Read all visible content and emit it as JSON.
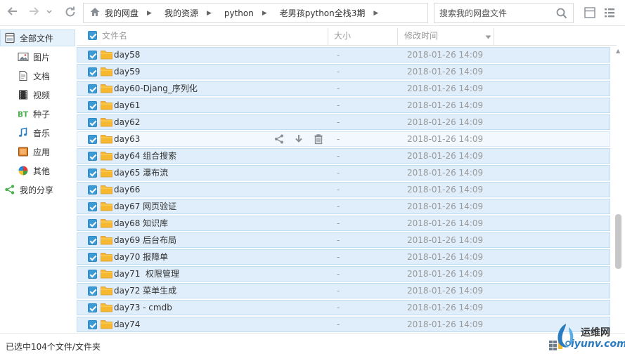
{
  "toolbar": {
    "breadcrumbs": [
      {
        "label": "我的网盘"
      },
      {
        "label": "我的资源"
      },
      {
        "label": "python"
      },
      {
        "label": "老男孩python全栈3期"
      }
    ],
    "search_placeholder": "搜索我的网盘文件"
  },
  "sidebar": {
    "items": [
      {
        "label": "全部文件",
        "icon": "all-files-icon",
        "active": true
      },
      {
        "label": "图片",
        "icon": "image-icon"
      },
      {
        "label": "文档",
        "icon": "document-icon"
      },
      {
        "label": "视频",
        "icon": "video-icon"
      },
      {
        "label": "种子",
        "icon": "bt-icon"
      },
      {
        "label": "音乐",
        "icon": "music-icon"
      },
      {
        "label": "应用",
        "icon": "app-icon"
      },
      {
        "label": "其他",
        "icon": "other-icon"
      },
      {
        "label": "我的分享",
        "icon": "share-icon"
      }
    ]
  },
  "list": {
    "columns": {
      "name": "文件名",
      "size": "大小",
      "modified": "修改时间"
    },
    "rows": [
      {
        "name": "day58",
        "size": "-",
        "modified": "2018-01-26 14:09"
      },
      {
        "name": "day59",
        "size": "-",
        "modified": "2018-01-26 14:09"
      },
      {
        "name": "day60-Djang_序列化",
        "size": "-",
        "modified": "2018-01-26 14:09"
      },
      {
        "name": "day61",
        "size": "-",
        "modified": "2018-01-26 14:09"
      },
      {
        "name": "day62",
        "size": "-",
        "modified": "2018-01-26 14:09"
      },
      {
        "name": "day63",
        "size": "-",
        "modified": "2018-01-26 14:09",
        "hover": true
      },
      {
        "name": "day64 组合搜索",
        "size": "-",
        "modified": "2018-01-26 14:09"
      },
      {
        "name": "day65 瀑布流",
        "size": "-",
        "modified": "2018-01-26 14:09"
      },
      {
        "name": "day66",
        "size": "-",
        "modified": "2018-01-26 14:09"
      },
      {
        "name": "day67 网页验证",
        "size": "-",
        "modified": "2018-01-26 14:09"
      },
      {
        "name": "day68 知识库",
        "size": "-",
        "modified": "2018-01-26 14:09"
      },
      {
        "name": "day69 后台布局",
        "size": "-",
        "modified": "2018-01-26 14:09"
      },
      {
        "name": "day70 报障单",
        "size": "-",
        "modified": "2018-01-26 14:09"
      },
      {
        "name": "day71  权限管理",
        "size": "-",
        "modified": "2018-01-26 14:09"
      },
      {
        "name": "day72 菜单生成",
        "size": "-",
        "modified": "2018-01-26 14:09"
      },
      {
        "name": "day73 - cmdb",
        "size": "-",
        "modified": "2018-01-26 14:09"
      },
      {
        "name": "day74",
        "size": "-",
        "modified": "2018-01-26 14:09"
      }
    ]
  },
  "status": {
    "selected_text": "已选中104个文件/文件夹"
  },
  "watermark": {
    "site_cn": "运维网",
    "site_en": "iyunv.com"
  },
  "colors": {
    "accent": "#3c9ad6",
    "row_selected": "#dfeefa",
    "folder": "#f5b830"
  }
}
